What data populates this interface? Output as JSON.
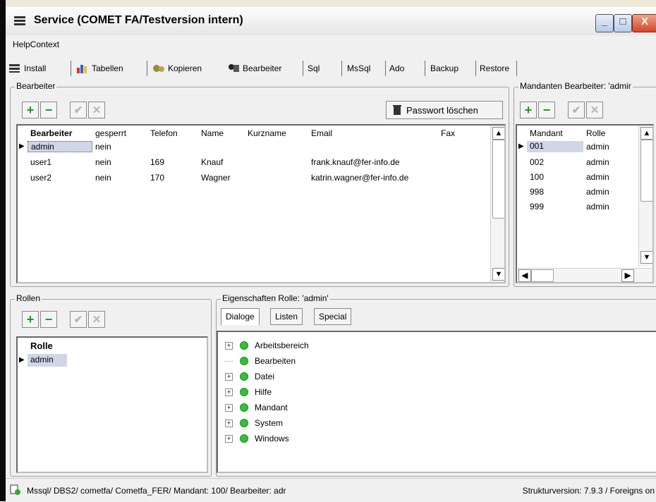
{
  "window": {
    "title": "Service (COMET FA/Testversion intern)",
    "min_label": "_",
    "max_label": "□",
    "close_label": "X"
  },
  "menu": {
    "helpcontext": "HelpContext"
  },
  "tabs": [
    {
      "label": "Install",
      "icon": "install-icon"
    },
    {
      "label": "Tabellen",
      "icon": "tables-icon"
    },
    {
      "label": "Kopieren",
      "icon": "copy-gears-icon"
    },
    {
      "label": "Bearbeiter",
      "icon": "user-edit-icon"
    },
    {
      "label": "Sql"
    },
    {
      "label": "MsSql"
    },
    {
      "label": "Ado"
    },
    {
      "label": "Backup"
    },
    {
      "label": "Restore"
    }
  ],
  "bearbeiter": {
    "legend": "Bearbeiter",
    "password_button": "Passwort löschen",
    "columns": [
      "Bearbeiter",
      "gesperrt",
      "Telefon",
      "Name",
      "Kurzname",
      "Email",
      "Fax"
    ],
    "rows": [
      [
        "admin",
        "nein",
        "",
        "",
        "",
        "",
        ""
      ],
      [
        "user1",
        "nein",
        "169",
        "Knauf",
        "",
        "frank.knauf@fer-info.de",
        ""
      ],
      [
        "user2",
        "nein",
        "170",
        "Wagner",
        "",
        "katrin.wagner@fer-info.de",
        ""
      ]
    ]
  },
  "mandanten": {
    "legend": "Mandanten Bearbeiter: 'admir",
    "columns": [
      "Mandant",
      "Rolle"
    ],
    "rows": [
      [
        "001",
        "admin"
      ],
      [
        "002",
        "admin"
      ],
      [
        "100",
        "admin"
      ],
      [
        "998",
        "admin"
      ],
      [
        "999",
        "admin"
      ]
    ]
  },
  "rollen": {
    "legend": "Rollen",
    "column": "Rolle",
    "rows": [
      "admin"
    ]
  },
  "eigenschaften": {
    "legend": "Eigenschaften Rolle: 'admin'",
    "tabs": [
      "Dialoge",
      "Listen",
      "Special"
    ],
    "tree": [
      {
        "label": "Arbeitsbereich",
        "expandable": true
      },
      {
        "label": "Bearbeiten",
        "expandable": false
      },
      {
        "label": "Datei",
        "expandable": true
      },
      {
        "label": "Hilfe",
        "expandable": true
      },
      {
        "label": "Mandant",
        "expandable": true
      },
      {
        "label": "System",
        "expandable": true
      },
      {
        "label": "Windows",
        "expandable": true
      }
    ]
  },
  "buttons": {
    "plus": "+",
    "minus": "−",
    "check": "✔",
    "cancel": "✕"
  },
  "status": {
    "left": "Mssql/ DBS2/ cometfa/ Cometfa_FER/ Mandant: 100/ Bearbeiter: adr",
    "right": "Strukturversion: 7.9.3 / Foreigns on"
  },
  "colors": {
    "selection": "#cfd6e8",
    "tree_dot": "#33c03a",
    "add_green": "#1c9a1c"
  }
}
